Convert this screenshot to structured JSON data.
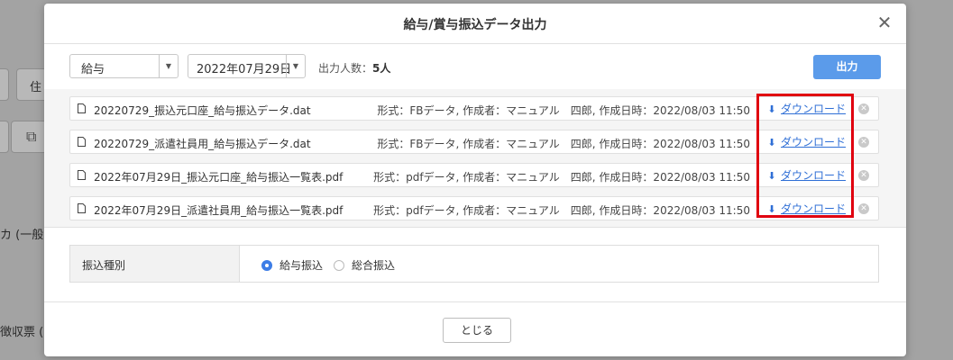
{
  "background": {
    "texts": [
      "住",
      "カ (一般",
      "徴収票 ("
    ]
  },
  "modal": {
    "title": "給与/賞与振込データ出力",
    "close": "✕",
    "toolbar": {
      "type_select": "給与",
      "date_select": "2022年07月29日",
      "count_label": "出力人数：",
      "count_value": "5人",
      "output_button": "出力"
    },
    "files": [
      {
        "name": "20220729_振込元口座_給与振込データ.dat",
        "meta": "形式：FBデータ, 作成者：マニュアル　四郎, 作成日時：2022/08/03 11:50",
        "download": "ダウンロード"
      },
      {
        "name": "20220729_派遣社員用_給与振込データ.dat",
        "meta": "形式：FBデータ, 作成者：マニュアル　四郎, 作成日時：2022/08/03 11:50",
        "download": "ダウンロード"
      },
      {
        "name": "2022年07月29日_振込元口座_給与振込一覧表.pdf",
        "meta": "形式：pdfデータ, 作成者：マニュアル　四郎, 作成日時：2022/08/03 11:50",
        "download": "ダウンロード"
      },
      {
        "name": "2022年07月29日_派遣社員用_給与振込一覧表.pdf",
        "meta": "形式：pdfデータ, 作成者：マニュアル　四郎, 作成日時：2022/08/03 11:50",
        "download": "ダウンロード"
      }
    ],
    "transfer": {
      "label": "振込種別",
      "options": [
        "給与振込",
        "総合振込"
      ],
      "selected": "給与振込"
    },
    "footer_button": "とじる"
  },
  "colors": {
    "accent": "#5b9bea",
    "link": "#2f6fd6",
    "highlight": "#e0000f"
  }
}
